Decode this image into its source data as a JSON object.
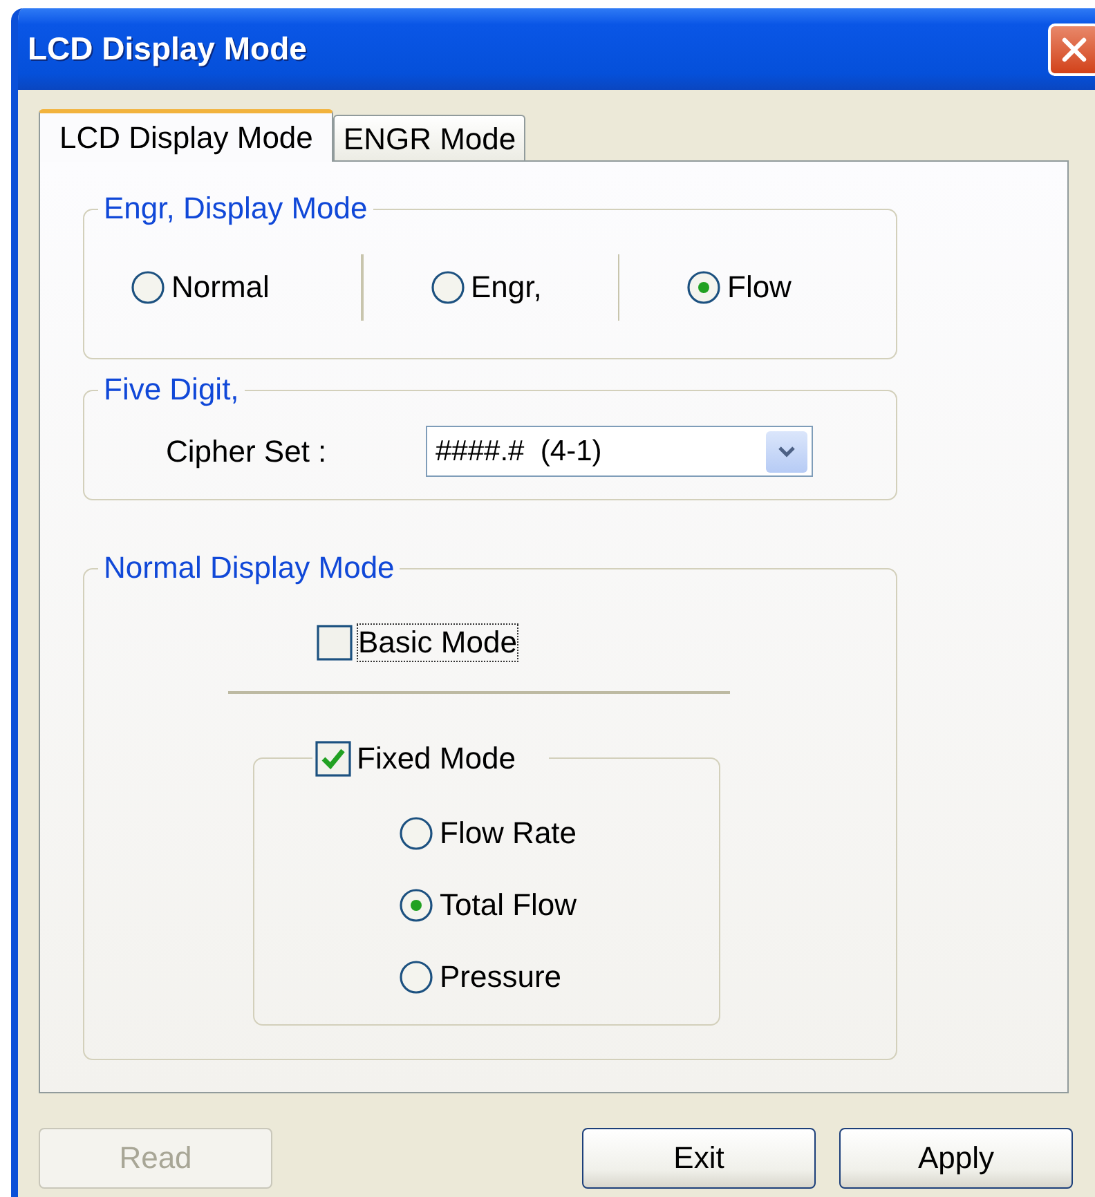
{
  "window": {
    "title": "LCD Display Mode"
  },
  "tabs": [
    {
      "label": "LCD Display Mode",
      "selected": true
    },
    {
      "label": "ENGR Mode",
      "selected": false
    }
  ],
  "engr_display_mode": {
    "title": "Engr, Display Mode",
    "options": [
      {
        "label": "Normal",
        "selected": false
      },
      {
        "label": "Engr,",
        "selected": false
      },
      {
        "label": "Flow",
        "selected": true
      }
    ]
  },
  "five_digit": {
    "title": "Five Digit,",
    "label": "Cipher Set :",
    "value": "####.#  (4-1)"
  },
  "normal_display_mode": {
    "title": "Normal Display Mode",
    "basic_mode": {
      "label": "Basic Mode",
      "checked": false
    },
    "fixed_mode": {
      "label": "Fixed Mode",
      "checked": true,
      "options": [
        {
          "label": "Flow Rate",
          "selected": false
        },
        {
          "label": "Total Flow",
          "selected": true
        },
        {
          "label": "Pressure",
          "selected": false
        }
      ]
    }
  },
  "buttons": [
    {
      "label": "Read",
      "disabled": true
    },
    {
      "label": "Exit",
      "disabled": false
    },
    {
      "label": "Apply",
      "disabled": false
    }
  ]
}
